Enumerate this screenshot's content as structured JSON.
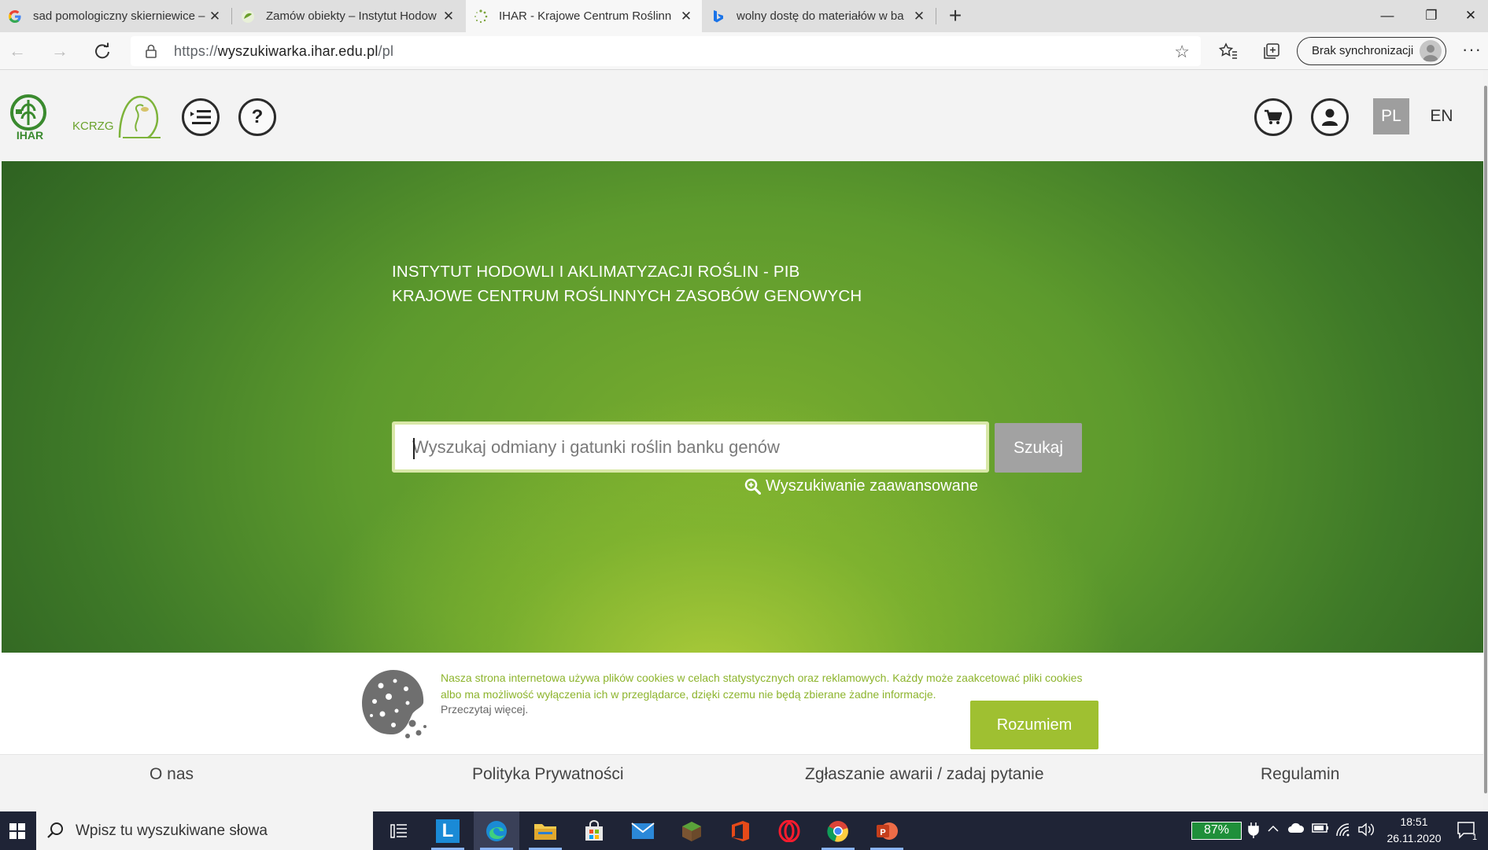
{
  "browser": {
    "tabs": [
      {
        "title": "sad pomologiczny skierniewice –",
        "favicon": "google-g-icon",
        "close": "✕"
      },
      {
        "title": "Zamów obiekty – Instytut Hodow",
        "favicon": "ihar-leaf-icon",
        "close": "✕"
      },
      {
        "title": "IHAR - Krajowe Centrum Roślinn",
        "favicon": "loading-spinner-icon",
        "close": "✕"
      },
      {
        "title": "wolny dostę do materiałów w ba",
        "favicon": "bing-icon",
        "close": "✕"
      }
    ],
    "new_tab": "+",
    "window_controls": {
      "minimize": "—",
      "restore": "❐",
      "close": "✕"
    },
    "url": {
      "scheme": "https://",
      "host": "wyszukiwarka.ihar.edu.pl",
      "path": "/pl"
    },
    "sync_label": "Brak synchronizacji",
    "more": "···"
  },
  "site": {
    "header": {
      "lang_pl": "PL",
      "lang_en": "EN",
      "help": "?",
      "logo_ihar_text": "IHAR",
      "logo_kcrzg_text": "KCRZG"
    },
    "hero": {
      "title_line1": "INSTYTUT HODOWLI I AKLIMATYZACJI ROŚLIN - PIB",
      "title_line2": "KRAJOWE CENTRUM ROŚLINNYCH ZASOBÓW GENOWYCH",
      "search_placeholder": "Wyszukaj odmiany i gatunki roślin banku genów",
      "search_button": "Szukaj",
      "advanced_search": "Wyszukiwanie zaawansowane"
    },
    "cookie": {
      "text": "Nasza strona internetowa używa plików cookies w celach statystycznych oraz reklamowych. Każdy może zaakcetować pliki cookies albo ma możliwość wyłączenia ich w przeglądarce, dzięki czemu nie będą zbierane żadne informacje.",
      "read_more": "Przeczytaj więcej.",
      "accept_button": "Rozumiem"
    },
    "footer": {
      "links": [
        "O nas",
        "Polityka Prywatności",
        "Zgłaszanie awarii / zadaj pytanie",
        "Regulamin"
      ]
    }
  },
  "taskbar": {
    "search_placeholder": "Wpisz tu wyszukiwane słowa",
    "battery": "87%",
    "time": "18:51",
    "date": "26.11.2020",
    "notifications": "1"
  },
  "colors": {
    "hero_green": "#5d9a2d",
    "accent_lime": "#9fc031",
    "cookie_text": "#8db42d"
  }
}
